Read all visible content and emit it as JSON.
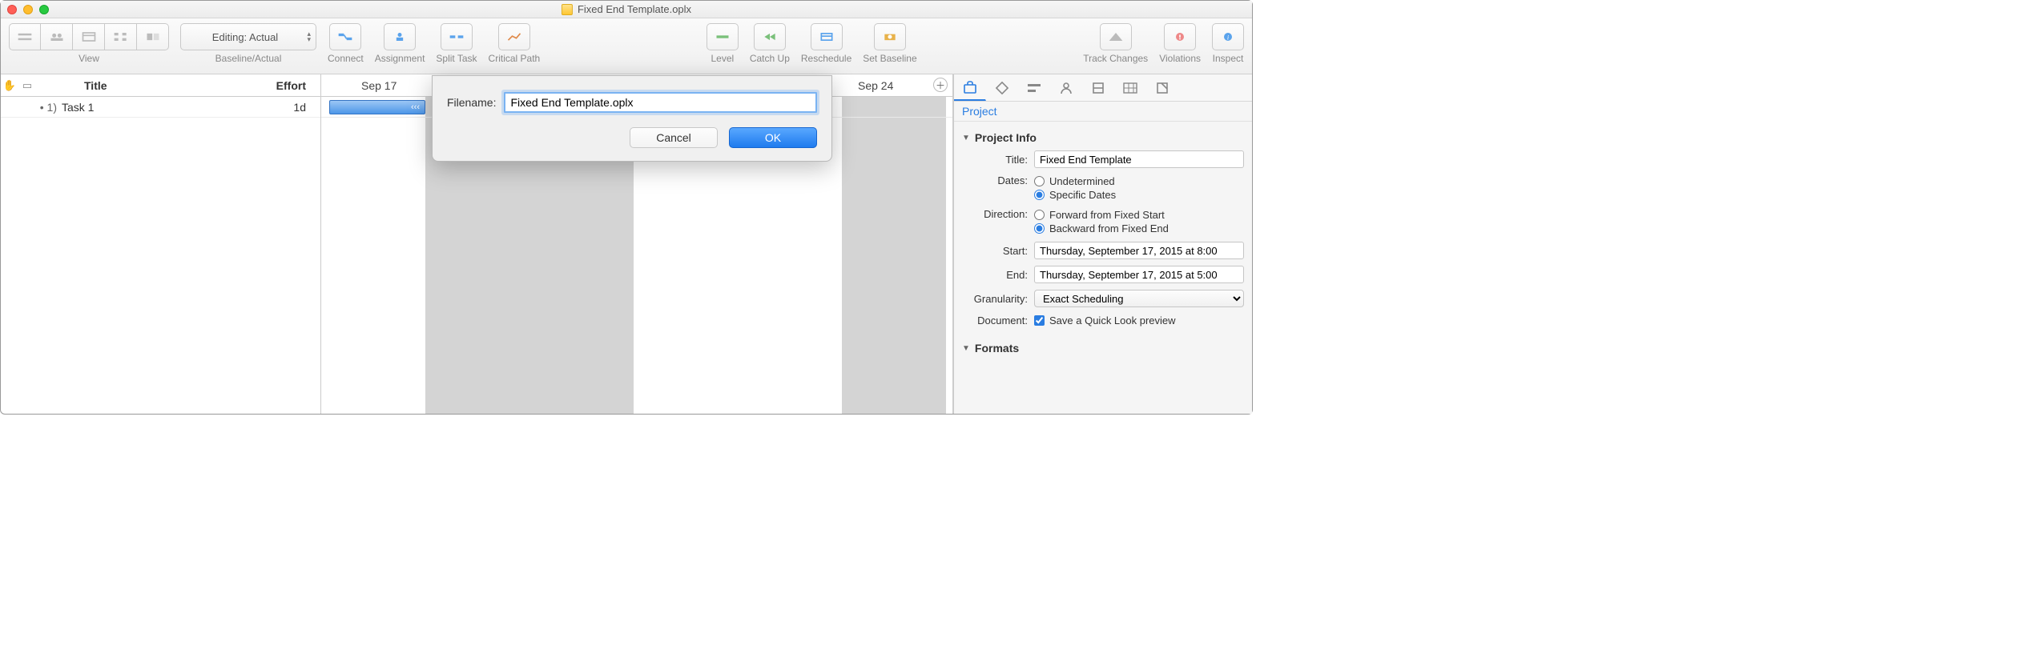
{
  "window": {
    "title": "Fixed End Template.oplx"
  },
  "toolbar": {
    "view_label": "View",
    "baseline_label": "Baseline/Actual",
    "baseline_value": "Editing: Actual",
    "connect": "Connect",
    "assignment": "Assignment",
    "split_task": "Split Task",
    "critical_path": "Critical Path",
    "level": "Level",
    "catch_up": "Catch Up",
    "reschedule": "Reschedule",
    "set_baseline": "Set Baseline",
    "track_changes": "Track Changes",
    "violations": "Violations",
    "inspect": "Inspect"
  },
  "outline": {
    "col_title": "Title",
    "col_effort": "Effort",
    "rows": [
      {
        "index": "1)",
        "title": "Task 1",
        "effort": "1d"
      }
    ]
  },
  "gantt": {
    "date1": "Sep 17",
    "date2": "Sep 24",
    "bar_text": "‹‹‹"
  },
  "modal": {
    "label": "Filename:",
    "value": "Fixed End Template.oplx",
    "cancel": "Cancel",
    "ok": "OK"
  },
  "inspector": {
    "tab_label": "Project",
    "sections": {
      "project_info": "Project Info",
      "formats": "Formats"
    },
    "fields": {
      "title_label": "Title:",
      "title_value": "Fixed End Template",
      "dates_label": "Dates:",
      "dates_opt1": "Undetermined",
      "dates_opt2": "Specific Dates",
      "direction_label": "Direction:",
      "direction_opt1": "Forward from Fixed Start",
      "direction_opt2": "Backward from Fixed End",
      "start_label": "Start:",
      "start_value": "Thursday, September 17, 2015 at 8:00",
      "end_label": "End:",
      "end_value": "Thursday, September 17, 2015 at 5:00",
      "granularity_label": "Granularity:",
      "granularity_value": "Exact Scheduling",
      "document_label": "Document:",
      "document_opt": "Save a Quick Look preview"
    }
  }
}
